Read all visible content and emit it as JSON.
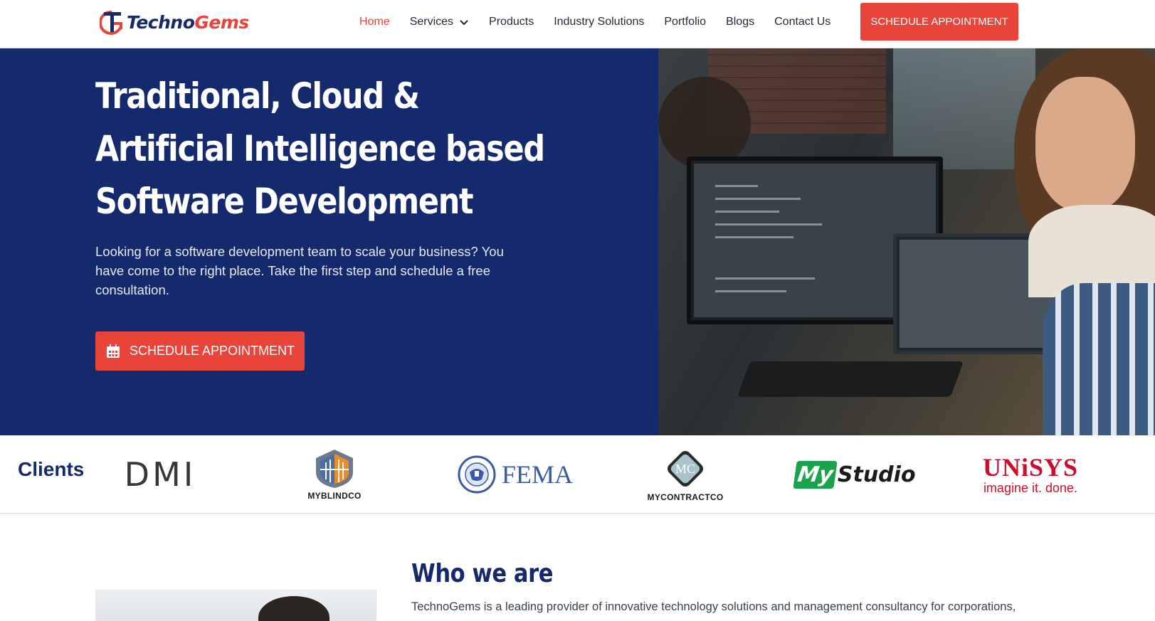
{
  "brand": {
    "name_part1": "Techno",
    "name_part2": "Gems",
    "accent": "#e8443a",
    "navy": "#152a6c"
  },
  "nav": {
    "items": [
      {
        "label": "Home",
        "active": true
      },
      {
        "label": "Services",
        "has_dropdown": true
      },
      {
        "label": "Products"
      },
      {
        "label": "Industry Solutions"
      },
      {
        "label": "Portfolio"
      },
      {
        "label": "Blogs"
      },
      {
        "label": "Contact Us"
      }
    ],
    "cta_label": "SCHEDULE APPOINTMENT"
  },
  "hero": {
    "title": "Traditional, Cloud & Artificial Intelligence based Software Development",
    "subtitle": "Looking for a software development team to scale your business? You have come to the right place. Take the first step and schedule a free consultation.",
    "cta_label": "SCHEDULE APPOINTMENT",
    "cta_icon": "calendar-icon"
  },
  "clients": {
    "label": "Clients",
    "logos": [
      {
        "name": "DMI",
        "text": "DMI"
      },
      {
        "name": "MyBlindCo",
        "text": "MYBLINDCO"
      },
      {
        "name": "FEMA",
        "text": "FEMA"
      },
      {
        "name": "MyContractCo",
        "text": "MYCONTRACTCO",
        "mark": "MC"
      },
      {
        "name": "MyStudio",
        "text_my": "My",
        "text_studio": "Studio"
      },
      {
        "name": "Unisys",
        "text_top": "UNiSYS",
        "text_bottom": "imagine it. done."
      }
    ]
  },
  "who": {
    "title": "Who we are",
    "text": "TechnoGems is a leading provider of innovative technology solutions and management consultancy for corporations,"
  }
}
